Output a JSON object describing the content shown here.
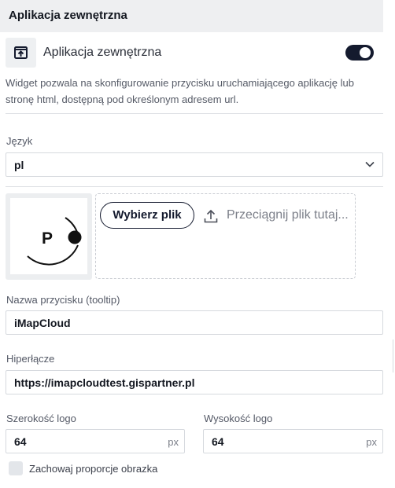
{
  "panel": {
    "title": "Aplikacja zewnętrzna"
  },
  "widget": {
    "icon": "open-in-app-icon",
    "label": "Aplikacja zewnętrzna",
    "enabled": true,
    "description": "Widget pozwala na skonfigurowanie przycisku uruchamiającego aplikację lub stronę html, dostępną pod określonym adresem url."
  },
  "language": {
    "label": "Język",
    "value": "pl"
  },
  "logo_upload": {
    "choose_label": "Wybierz plik",
    "drop_text": "Przeciągnij plik tutaj...",
    "preview_letter": "P"
  },
  "button_name": {
    "label": "Nazwa przycisku (tooltip)",
    "value": "iMapCloud"
  },
  "hyperlink": {
    "label": "Hiperłącze",
    "value": "https://imapcloudtest.gispartner.pl"
  },
  "logo_width": {
    "label": "Szerokość logo",
    "value": "64",
    "unit": "px"
  },
  "logo_height": {
    "label": "Wysokość logo",
    "value": "64",
    "unit": "px"
  },
  "keep_ratio": {
    "label": "Zachowaj proporcje obrazka",
    "checked": false
  },
  "colors": {
    "accent": "#141a2e",
    "header_bg": "#eeeff1"
  }
}
